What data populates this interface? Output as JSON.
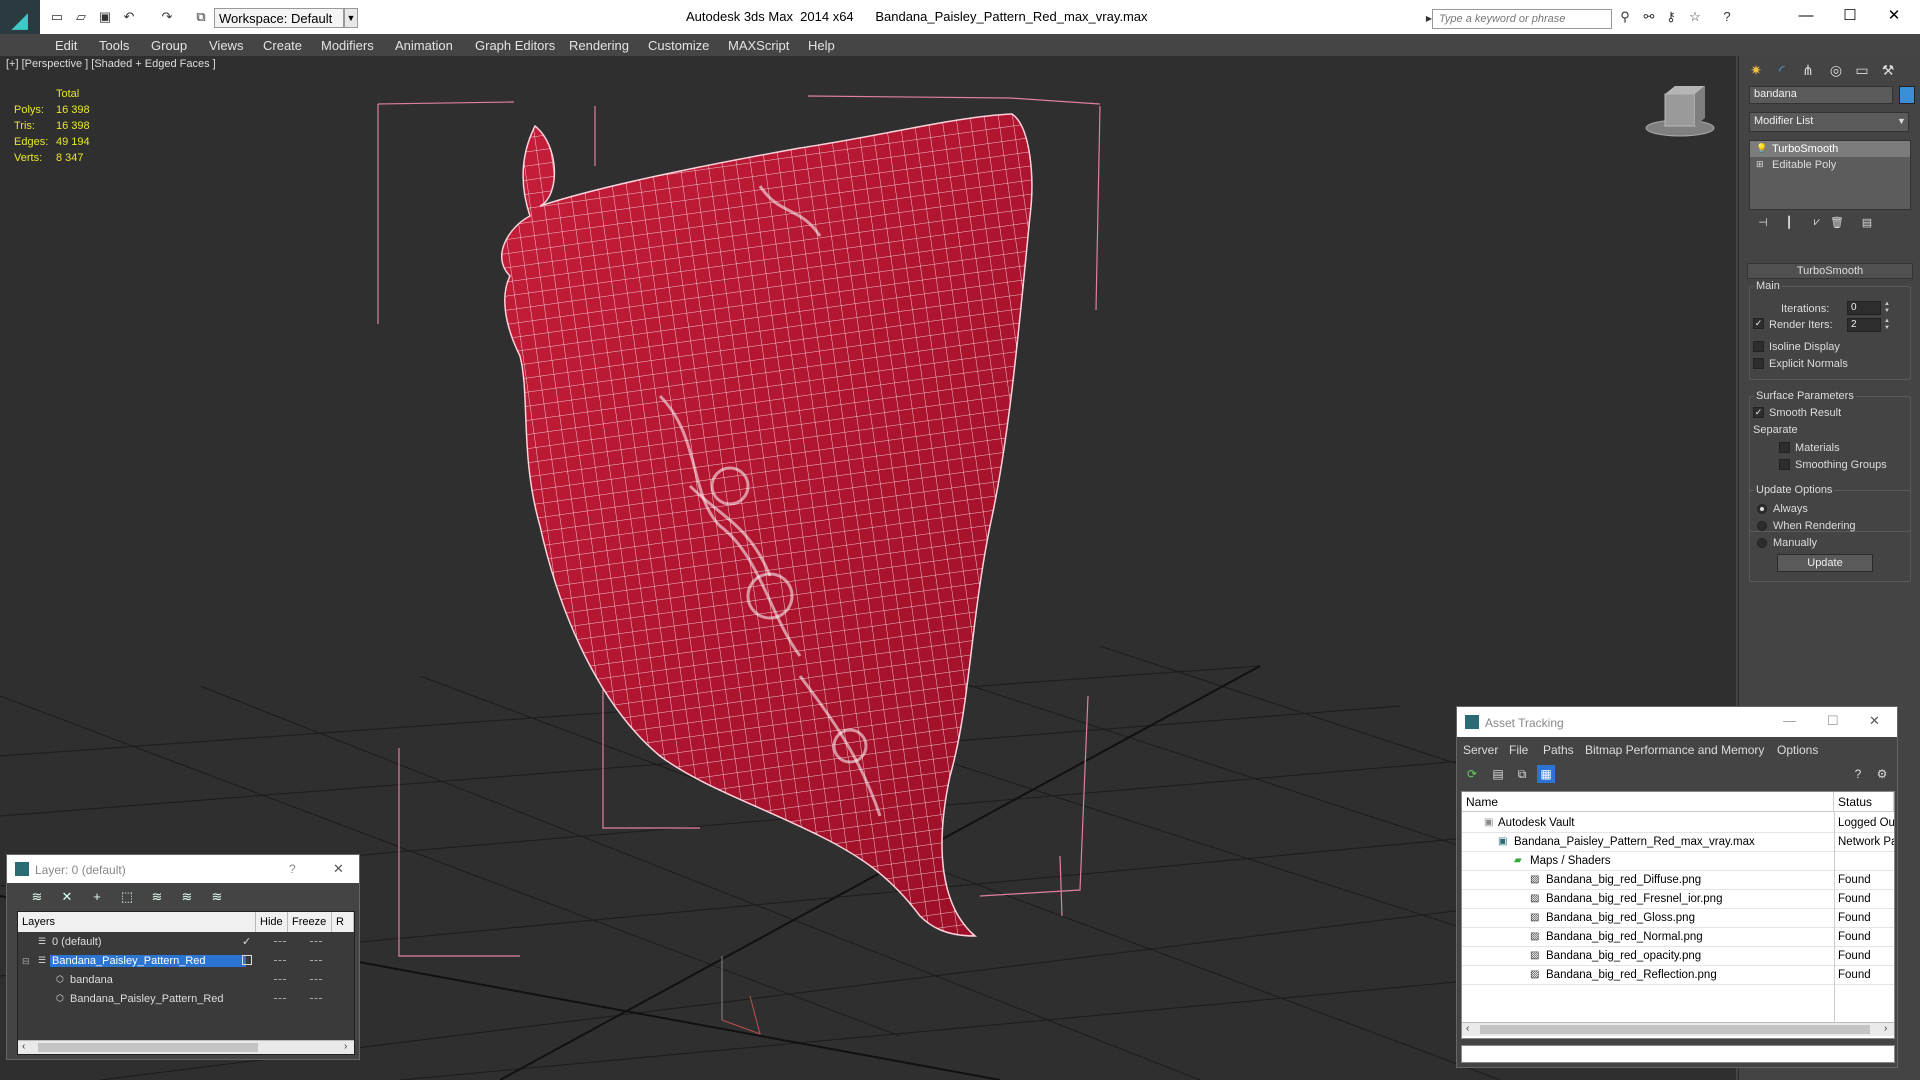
{
  "titlebar": {
    "workspace": "Workspace: Default",
    "app": "Autodesk 3ds Max  2014 x64",
    "file": "Bandana_Paisley_Pattern_Red_max_vray.max",
    "search_placeholder": "Type a keyword or phrase"
  },
  "menu": [
    "Edit",
    "Tools",
    "Group",
    "Views",
    "Create",
    "Modifiers",
    "Animation",
    "Graph Editors",
    "Rendering",
    "Customize",
    "MAXScript",
    "Help"
  ],
  "viewport": {
    "label": "[+] [Perspective ] [Shaded + Edged Faces ]",
    "stats": {
      "header": "Total",
      "polys_label": "Polys:",
      "polys": "16 398",
      "tris_label": "Tris:",
      "tris": "16 398",
      "edges_label": "Edges:",
      "edges": "49 194",
      "verts_label": "Verts:",
      "verts": "8 347"
    }
  },
  "command_panel": {
    "object_name": "bandana",
    "object_color": "#3b8fd6",
    "modifier_list": "Modifier List",
    "stack": [
      "TurboSmooth",
      "Editable Poly"
    ],
    "turbosmooth": {
      "title": "TurboSmooth",
      "main": "Main",
      "iterations_label": "Iterations:",
      "iterations": "0",
      "render_iters_label": "Render Iters:",
      "render_iters": "2",
      "render_iters_checked": true,
      "isoline": "Isoline Display",
      "explicit_normals": "Explicit Normals",
      "surface_params": "Surface Parameters",
      "smooth_result": "Smooth Result",
      "separate": "Separate",
      "materials": "Materials",
      "smoothing_groups": "Smoothing Groups",
      "update_options": "Update Options",
      "always": "Always",
      "when_rendering": "When Rendering",
      "manually": "Manually",
      "update": "Update"
    }
  },
  "layer_dialog": {
    "title": "Layer: 0 (default)",
    "help": "?",
    "close": "✕",
    "columns": [
      "Layers",
      "Hide",
      "Freeze",
      "R"
    ],
    "rows": [
      {
        "name": "0 (default)",
        "indent": 0
      },
      {
        "name": "Bandana_Paisley_Pattern_Red",
        "indent": 0
      },
      {
        "name": "bandana",
        "indent": 1
      },
      {
        "name": "Bandana_Paisley_Pattern_Red",
        "indent": 1
      }
    ]
  },
  "asset_tracking": {
    "title": "Asset Tracking",
    "menu": [
      "Server",
      "File",
      "Paths",
      "Bitmap Performance and Memory",
      "Options"
    ],
    "columns": [
      "Name",
      "Status"
    ],
    "rows": [
      {
        "name": "Autodesk Vault",
        "status": "Logged Ou",
        "indent": 0
      },
      {
        "name": "Bandana_Paisley_Pattern_Red_max_vray.max",
        "status": "Network Pa",
        "indent": 1
      },
      {
        "name": "Maps / Shaders",
        "status": "",
        "indent": 2
      },
      {
        "name": "Bandana_big_red_Diffuse.png",
        "status": "Found",
        "indent": 3
      },
      {
        "name": "Bandana_big_red_Fresnel_ior.png",
        "status": "Found",
        "indent": 3
      },
      {
        "name": "Bandana_big_red_Gloss.png",
        "status": "Found",
        "indent": 3
      },
      {
        "name": "Bandana_big_red_Normal.png",
        "status": "Found",
        "indent": 3
      },
      {
        "name": "Bandana_big_red_opacity.png",
        "status": "Found",
        "indent": 3
      },
      {
        "name": "Bandana_big_red_Reflection.png",
        "status": "Found",
        "indent": 3
      }
    ]
  }
}
